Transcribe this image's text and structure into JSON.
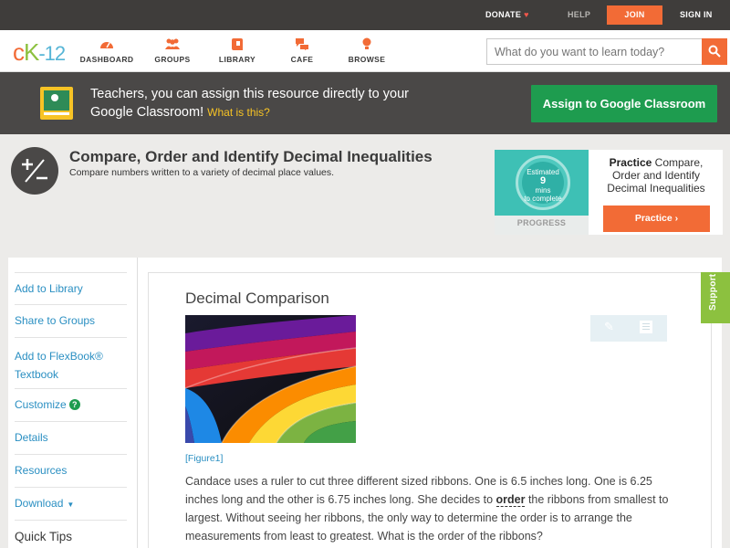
{
  "topbar": {
    "donate": "DONATE",
    "help": "HELP",
    "join": "JOIN",
    "signin": "SIGN IN"
  },
  "header": {
    "logo_c": "c",
    "logo_k": "K",
    "logo_n": "-12",
    "nav": [
      {
        "label": "DASHBOARD",
        "icon": "dashboard-icon"
      },
      {
        "label": "GROUPS",
        "icon": "groups-icon"
      },
      {
        "label": "LIBRARY",
        "icon": "library-icon"
      },
      {
        "label": "CAFE",
        "icon": "cafe-icon"
      },
      {
        "label": "BROWSE",
        "icon": "browse-icon"
      }
    ],
    "search_placeholder": "What do you want to learn today?"
  },
  "banner": {
    "text": "Teachers, you can assign this resource directly to your Google Classroom!",
    "link": "What is this?",
    "button": "Assign to Google Classroom"
  },
  "title": {
    "heading": "Compare, Order and Identify Decimal Inequalities",
    "subheading": "Compare numbers written to a variety of decimal place values."
  },
  "practice": {
    "estimated": "Estimated",
    "mins": "9",
    "mins_unit": "mins",
    "to_complete": "to complete",
    "progress": "PROGRESS",
    "label_bold": "Practice",
    "label_rest": " Compare, Order and Identify Decimal Inequalities",
    "button": "Practice"
  },
  "sidebar": {
    "items": [
      "Add to Library",
      "Share to Groups",
      "Add to FlexBook® Textbook",
      "Customize",
      "Details",
      "Resources",
      "Download"
    ],
    "quick_tips": "Quick Tips"
  },
  "content": {
    "title": "Decimal Comparison",
    "figure_caption": "[Figure1]",
    "para_part1": "Candace uses a ruler to cut three different sized ribbons. One is 6.5 inches long. One is 6.25 inches long and the other is 6.75 inches long. She decides to ",
    "para_highlight": "order",
    "para_part2": " the ribbons from smallest to largest. Without seeing her ribbons, the only way to determine the order is to arrange the measurements from least to greatest. What is the order of the ribbons?"
  },
  "support": "Support",
  "colors": {
    "accent_orange": "#f26b36",
    "brand_green": "#8cc13f",
    "link_blue": "#2a8fc2",
    "classroom_green": "#1e9c4f"
  }
}
